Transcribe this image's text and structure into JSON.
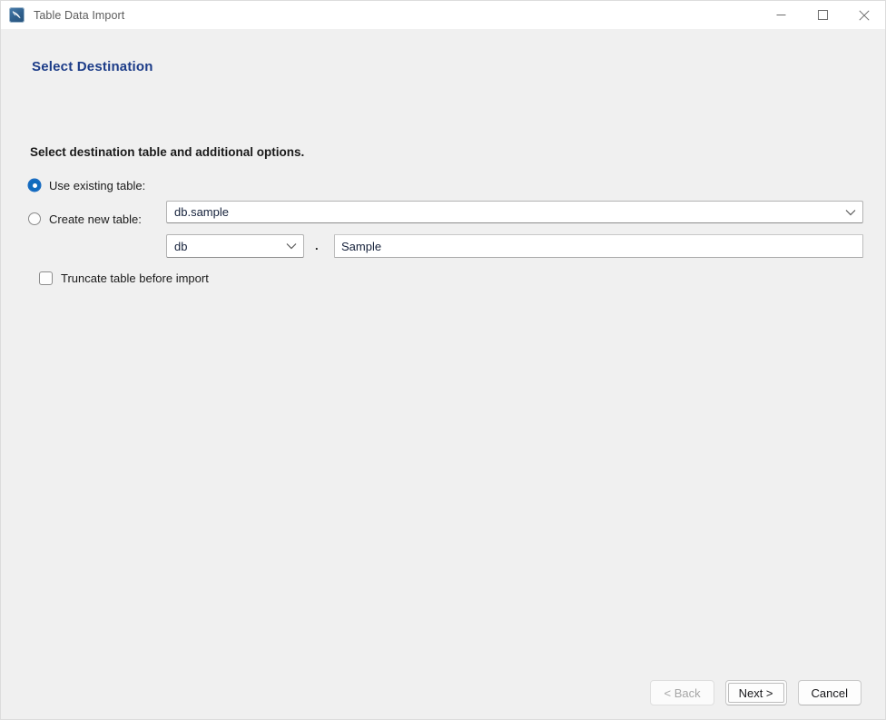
{
  "window": {
    "title": "Table Data Import",
    "app_icon": "mysql-workbench-dolphin-icon",
    "controls": {
      "minimize": "minimize-icon",
      "maximize": "maximize-icon",
      "close": "close-icon"
    }
  },
  "page": {
    "header": "Select Destination",
    "section_label": "Select destination table and additional options."
  },
  "destination": {
    "existing": {
      "radio_label": "Use existing table:",
      "selected": true,
      "combo_value": "db.sample",
      "chevron": "chevron-down-icon"
    },
    "create_new": {
      "radio_label": "Create new table:",
      "selected": false,
      "schema_value": "db",
      "chevron": "chevron-down-icon",
      "separator": ".",
      "table_name_value": "Sample",
      "table_name_placeholder": ""
    },
    "truncate": {
      "label": "Truncate table before import",
      "checked": false
    }
  },
  "footer": {
    "back_label": "< Back",
    "next_label": "Next >",
    "cancel_label": "Cancel"
  },
  "colors": {
    "accent_blue": "#0f6cbd",
    "header_blue": "#1c3c88",
    "window_bg": "#f0f0f0",
    "titlebar_bg": "#ffffff"
  }
}
